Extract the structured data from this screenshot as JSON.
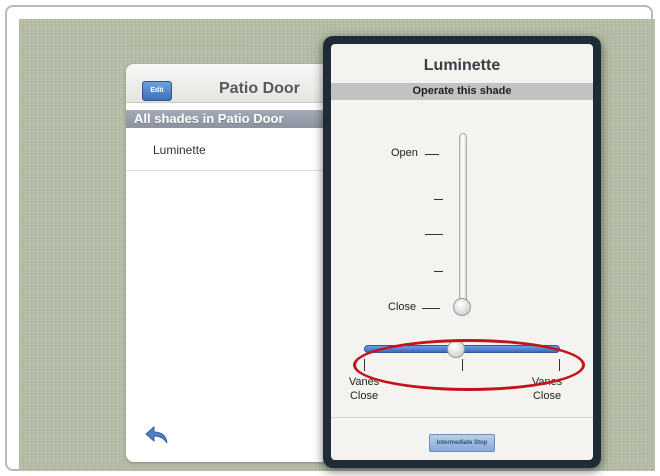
{
  "list": {
    "edit_label": "Edit",
    "title": "Patio Door",
    "section": "All shades in Patio Door",
    "items": [
      {
        "label": "Luminette"
      }
    ]
  },
  "detail": {
    "title": "Luminette",
    "subtitle": "Operate this shade",
    "vertical_slider": {
      "top_label": "Open",
      "bottom_label": "Close",
      "value": 0
    },
    "vane_slider": {
      "left_label": "Vanes Close",
      "right_label": "Vanes Close",
      "value": 0.5
    },
    "button_label": "Intermediate Stop"
  },
  "icons": {
    "back": "back-arrow-icon"
  },
  "colors": {
    "accent_blue": "#4a78c8",
    "highlight_red": "#c1141b",
    "background": "#b5bca6"
  }
}
